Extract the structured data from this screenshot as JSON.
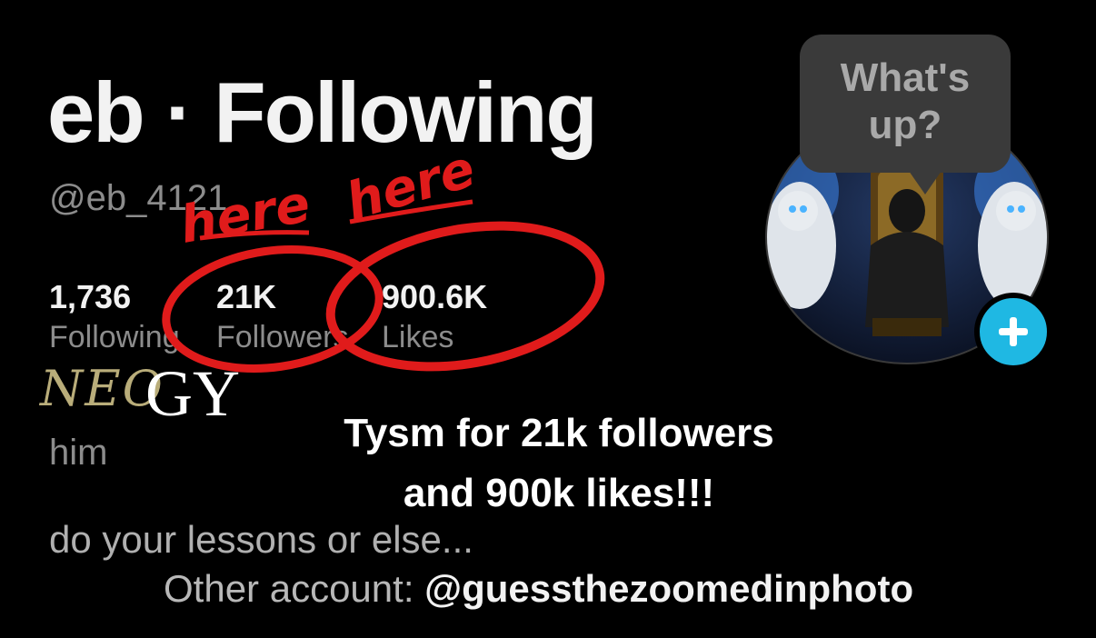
{
  "profile": {
    "title": "eb · Following",
    "handle": "@eb_4121",
    "stats": [
      {
        "value": "1,736",
        "label": "Following"
      },
      {
        "value": "21K",
        "label": "Followers"
      },
      {
        "value": "900.6K",
        "label": "Likes"
      }
    ],
    "bio_line1": "him",
    "bio_line2": "do your lessons or else...",
    "other_prefix": "Other account: ",
    "other_handle": "@guessthezoomedinphoto"
  },
  "avatar": {
    "bubble_text_line1": "What's",
    "bubble_text_line2": "up?",
    "add_icon": "plus-icon"
  },
  "overlay": {
    "caption_line1": "Tysm for 21k followers",
    "caption_line2": "and 900k likes!!!",
    "annotation_left": "here",
    "annotation_right": "here",
    "sticker_left": "NEO",
    "sticker_right": "GY"
  },
  "colors": {
    "background": "#000000",
    "annotation_red": "#e01b1b",
    "add_button": "#1fb8e3",
    "muted_text": "#8c8c8c"
  }
}
